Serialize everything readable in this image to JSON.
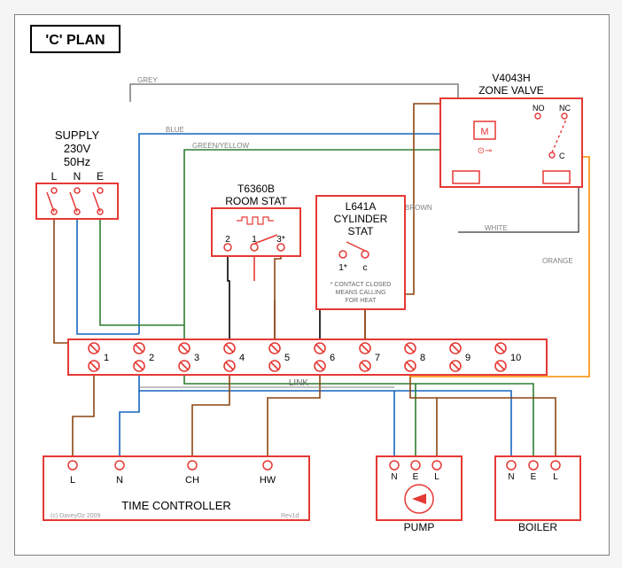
{
  "title": "'C' PLAN",
  "supply": {
    "label": "SUPPLY",
    "voltage": "230V",
    "freq": "50Hz",
    "L": "L",
    "N": "N",
    "E": "E"
  },
  "room_stat": {
    "model": "T6360B",
    "label": "ROOM STAT",
    "t1": "2",
    "t2": "1",
    "t3": "3*"
  },
  "cylinder_stat": {
    "model": "L641A",
    "label1": "CYLINDER",
    "label2": "STAT",
    "t1": "1*",
    "t2": "c",
    "note1": "* CONTACT CLOSED",
    "note2": "MEANS CALLING",
    "note3": "FOR HEAT"
  },
  "zone_valve": {
    "model": "V4043H",
    "label": "ZONE VALVE",
    "m": "M",
    "no": "NO",
    "nc": "NC",
    "c": "C",
    "sym": "⊙⊸"
  },
  "terminal_strip": {
    "labels": [
      "1",
      "2",
      "3",
      "4",
      "5",
      "6",
      "7",
      "8",
      "9",
      "10"
    ],
    "link": "LINK"
  },
  "time_controller": {
    "label": "TIME CONTROLLER",
    "L": "L",
    "N": "N",
    "CH": "CH",
    "HW": "HW"
  },
  "pump": {
    "label": "PUMP",
    "N": "N",
    "E": "E",
    "L": "L"
  },
  "boiler": {
    "label": "BOILER",
    "N": "N",
    "E": "E",
    "L": "L"
  },
  "wires": {
    "grey": "GREY",
    "blue": "BLUE",
    "green_yellow": "GREEN/YELLOW",
    "brown": "BROWN",
    "white": "WHITE",
    "orange": "ORANGE"
  },
  "colors": {
    "red": "#e53935",
    "brown": "#8b4513",
    "blue": "#1565c0",
    "green": "#2e7d32",
    "grey": "#808080",
    "orange": "#fb8c00",
    "black": "#000000"
  },
  "footer": {
    "copyright": "(c) DaveyOz 2009",
    "rev": "Rev1d"
  }
}
